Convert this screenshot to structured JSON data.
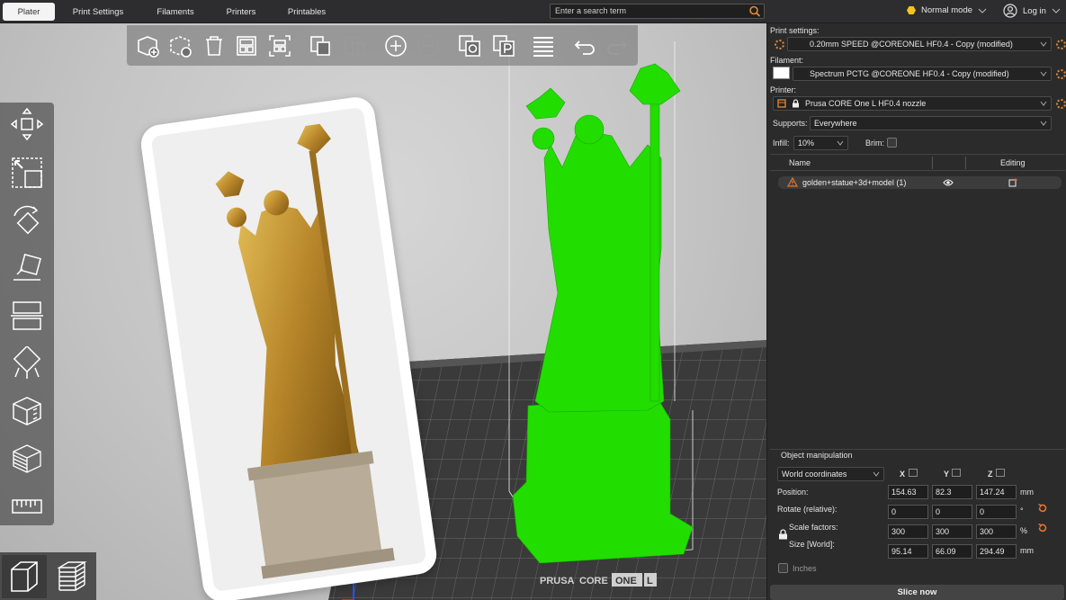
{
  "tabs": [
    {
      "label": "Plater",
      "active": true
    },
    {
      "label": "Print Settings",
      "active": false
    },
    {
      "label": "Filaments",
      "active": false
    },
    {
      "label": "Printers",
      "active": false
    },
    {
      "label": "Printables",
      "active": false
    }
  ],
  "search": {
    "placeholder": "Enter a search term"
  },
  "mode": {
    "label": "Normal mode",
    "color": "#f4c41a"
  },
  "account": {
    "label": "Log in"
  },
  "toolbar_icons": [
    "add-icon",
    "delete-icon",
    "delete-all-icon",
    "arrange-icon",
    "arrange-selection-icon",
    "copy-icon",
    "paste-icon",
    "add-instance-icon",
    "remove-instance-icon",
    "split-objects-icon",
    "split-parts-icon",
    "layers-editing-icon",
    "undo-icon",
    "redo-icon"
  ],
  "side_tools": [
    "move-icon",
    "scale-icon",
    "rotate-icon",
    "place-on-face-icon",
    "cut-icon",
    "paint-supports-icon",
    "seam-painting-icon",
    "variable-layer-icon",
    "measure-icon"
  ],
  "view_buttons": [
    "3d-view-icon",
    "preview-icon"
  ],
  "bed": {
    "brand_a": "PRUSA",
    "brand_b": "CORE",
    "brand_c": "ONE",
    "brand_d": "L"
  },
  "panel": {
    "print_settings_label": "Print settings:",
    "print_settings_value": "0.20mm SPEED @COREONEL HF0.4 - Copy (modified)",
    "filament_label": "Filament:",
    "filament_value": "Spectrum PCTG @COREONE HF0.4 - Copy (modified)",
    "filament_color": "#ffffff",
    "printer_label": "Printer:",
    "printer_value": "Prusa CORE One L HF0.4 nozzle",
    "supports_label": "Supports:",
    "supports_value": "Everywhere",
    "infill_label": "Infill:",
    "infill_value": "10%",
    "brim_label": "Brim:",
    "list_name_header": "Name",
    "list_editing_header": "Editing",
    "object_name": "golden+statue+3d+model (1)"
  },
  "manipulation": {
    "title": "Object manipulation",
    "coordinates": "World coordinates",
    "axes": [
      "X",
      "Y",
      "Z"
    ],
    "position_label": "Position:",
    "position": [
      "154.63",
      "82.3",
      "147.24"
    ],
    "position_unit": "mm",
    "rotate_label": "Rotate (relative):",
    "rotate": [
      "0",
      "0",
      "0"
    ],
    "rotate_unit": "°",
    "scale_label": "Scale factors:",
    "scale": [
      "300",
      "300",
      "300"
    ],
    "scale_unit": "%",
    "size_label": "Size [World]:",
    "size": [
      "95.14",
      "66.09",
      "294.49"
    ],
    "size_unit": "mm",
    "inches_label": "Inches"
  },
  "slice_button": "Slice now",
  "colors": {
    "model_green": "#22dd00",
    "accent_orange": "#e08a3a",
    "warning": "#e8742c"
  }
}
